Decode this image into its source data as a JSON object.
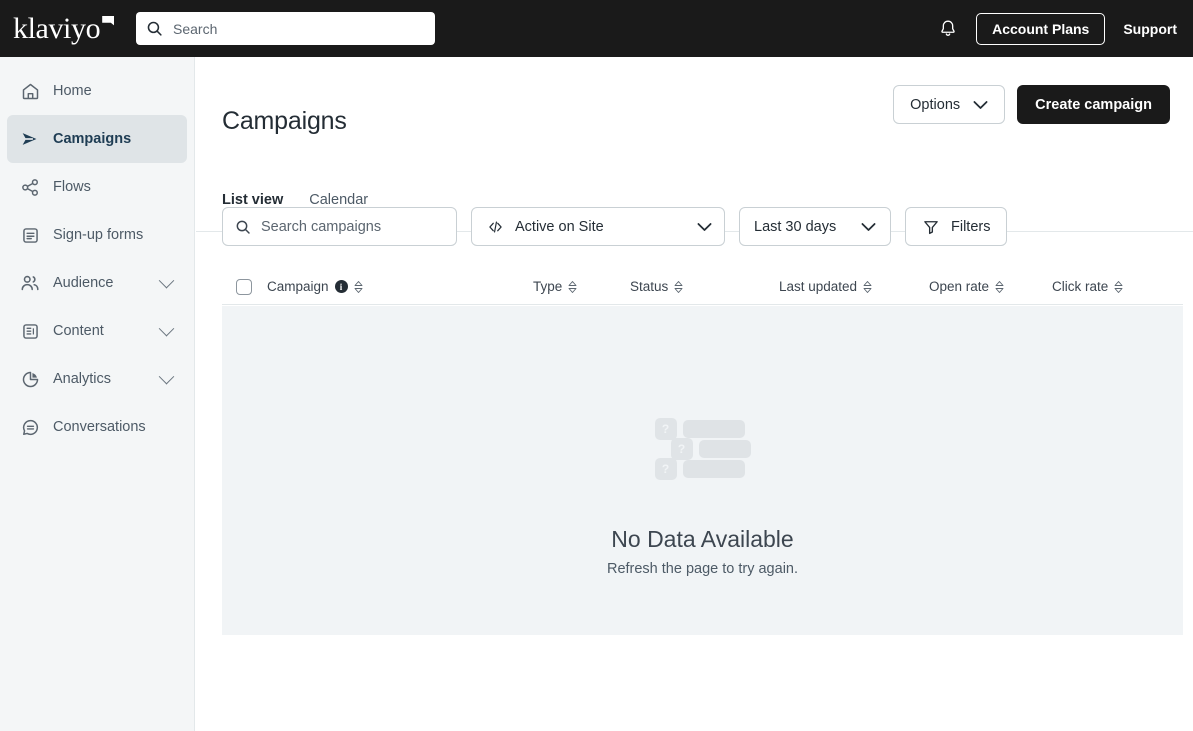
{
  "topbar": {
    "logo_text": "klaviyo",
    "logo_icon": "klaviyo-flag-mark",
    "search_placeholder": "Search",
    "search_value": "",
    "search_icon": "search-icon",
    "notifications_icon": "bell-icon",
    "account_plans_label": "Account Plans",
    "support_label": "Support"
  },
  "sidebar": {
    "items": [
      {
        "label": "Home",
        "icon": "home-icon",
        "active": false,
        "expandable": false
      },
      {
        "label": "Campaigns",
        "icon": "paper-plane-icon",
        "active": true,
        "expandable": false
      },
      {
        "label": "Flows",
        "icon": "flows-share-icon",
        "active": false,
        "expandable": false
      },
      {
        "label": "Sign-up forms",
        "icon": "form-icon",
        "active": false,
        "expandable": false
      },
      {
        "label": "Audience",
        "icon": "people-icon",
        "active": false,
        "expandable": true
      },
      {
        "label": "Content",
        "icon": "content-icon",
        "active": false,
        "expandable": true
      },
      {
        "label": "Analytics",
        "icon": "pie-chart-icon",
        "active": false,
        "expandable": true
      },
      {
        "label": "Conversations",
        "icon": "chat-icon",
        "active": false,
        "expandable": false
      }
    ]
  },
  "main": {
    "page_title": "Campaigns",
    "options_label": "Options",
    "options_icon": "chevron-down-icon",
    "create_campaign_label": "Create campaign",
    "tabs": [
      {
        "label": "List view",
        "selected": true
      },
      {
        "label": "Calendar",
        "selected": false
      }
    ]
  },
  "filters": {
    "search_placeholder": "Search campaigns",
    "search_value": "",
    "search_icon": "search-icon",
    "site_select": {
      "value": "Active on Site",
      "icon": "code-brackets-icon",
      "chevron": "chevron-down-icon"
    },
    "date_select": {
      "value": "Last 30 days",
      "chevron": "chevron-down-icon"
    },
    "filters_button": {
      "label": "Filters",
      "icon": "funnel-icon"
    }
  },
  "table": {
    "select_all_checkbox": {
      "checked": false,
      "name": "select-all"
    },
    "columns": [
      {
        "label": "Campaign",
        "info_icon": "info-icon",
        "sortable": true
      },
      {
        "label": "Type",
        "sortable": true
      },
      {
        "label": "Status",
        "sortable": true
      },
      {
        "label": "Last updated",
        "sortable": true
      },
      {
        "label": "Open rate",
        "sortable": true
      },
      {
        "label": "Click rate",
        "sortable": true
      }
    ],
    "empty_state": {
      "illustration": "no-data-placeholder-rows",
      "placeholder_glyph": "?",
      "title": "No Data Available",
      "subtitle": "Refresh the page to try again."
    }
  },
  "colors": {
    "topbar_bg": "#1a1a1a",
    "sidebar_bg": "#f4f6f7",
    "sidebar_active_bg": "#dfe4e7",
    "content_bg": "#ffffff",
    "table_body_bg": "#f1f4f6",
    "primary_button_bg": "#1a1a1a",
    "text_primary": "#242d35",
    "text_secondary": "#4d5a66",
    "border": "#c9d0d4"
  }
}
